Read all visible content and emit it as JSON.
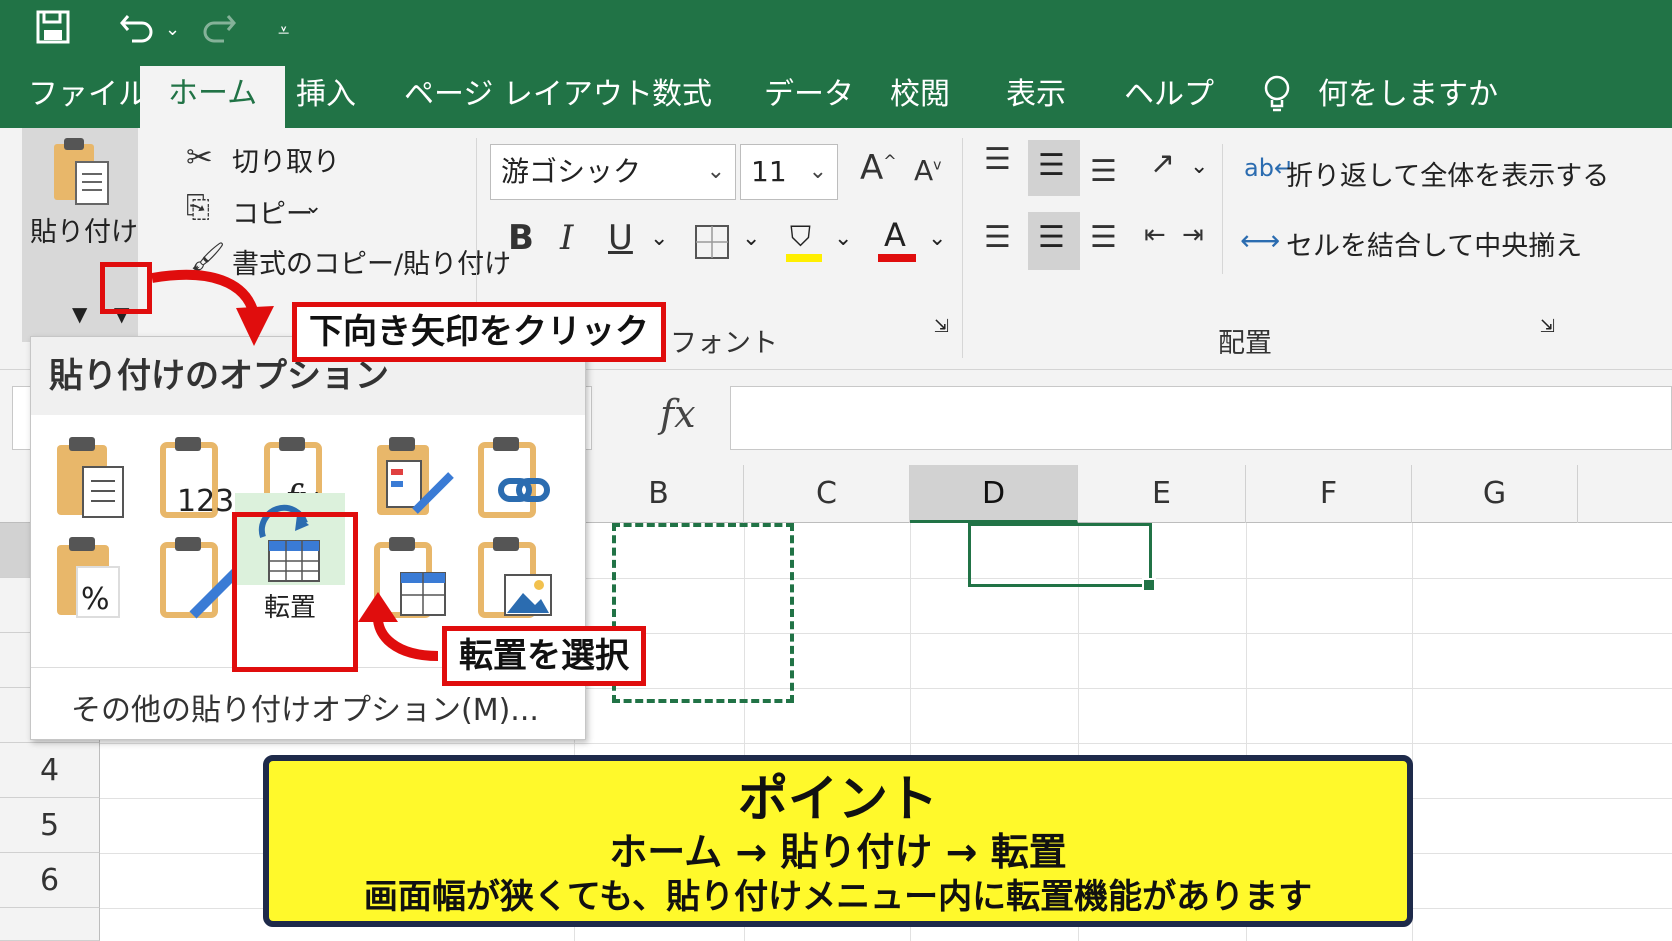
{
  "quick_access": {
    "save_icon": "save-icon",
    "undo_icon": "undo-icon",
    "redo_icon": "redo-icon",
    "customize_icon": "customize-qat-icon"
  },
  "tabs": [
    {
      "label": "ファイル",
      "active": false
    },
    {
      "label": "ホーム",
      "active": true
    },
    {
      "label": "挿入",
      "active": false
    },
    {
      "label": "ページ レイアウト",
      "active": false
    },
    {
      "label": "数式",
      "active": false
    },
    {
      "label": "データ",
      "active": false
    },
    {
      "label": "校閲",
      "active": false
    },
    {
      "label": "表示",
      "active": false
    },
    {
      "label": "ヘルプ",
      "active": false
    }
  ],
  "tell_me": "何をしますか",
  "clipboard": {
    "paste_label": "貼り付け",
    "cut_label": "切り取り",
    "copy_label": "コピー",
    "format_painter_label": "書式のコピー/貼り付け"
  },
  "font": {
    "name": "游ゴシック",
    "size": "11",
    "group_label": "フォント",
    "bold": "B",
    "italic": "I",
    "underline": "U",
    "font_color_letter": "A",
    "grow": "A",
    "shrink": "A",
    "highlight_color": "#ffef00",
    "font_color": "#e00d0d"
  },
  "alignment": {
    "wrap_label": "折り返して全体を表示する",
    "merge_label": "セルを結合して中央揃え",
    "group_label": "配置"
  },
  "formula_bar": {
    "fx": "fx"
  },
  "columns": [
    "B",
    "C",
    "D",
    "E",
    "F",
    "G"
  ],
  "rows": [
    "4",
    "5",
    "6"
  ],
  "paste_menu": {
    "title": "貼り付けのオプション",
    "selected_label": "転置",
    "more_options": "その他の貼り付けオプション(M)...",
    "icon_text_123": "123",
    "icon_text_fx": "fx",
    "icon_text_percent": "%"
  },
  "annotations": {
    "click_arrow": "下向き矢印をクリック",
    "select_transpose": "転置を選択"
  },
  "point_box": {
    "title": "ポイント",
    "path": "ホーム → 貼り付け → 転置",
    "note": "画面幅が狭くても、貼り付けメニュー内に転置機能があります"
  },
  "colors": {
    "excel_green": "#217346",
    "annotation_red": "#e00d0d",
    "point_yellow": "#fff92b"
  }
}
